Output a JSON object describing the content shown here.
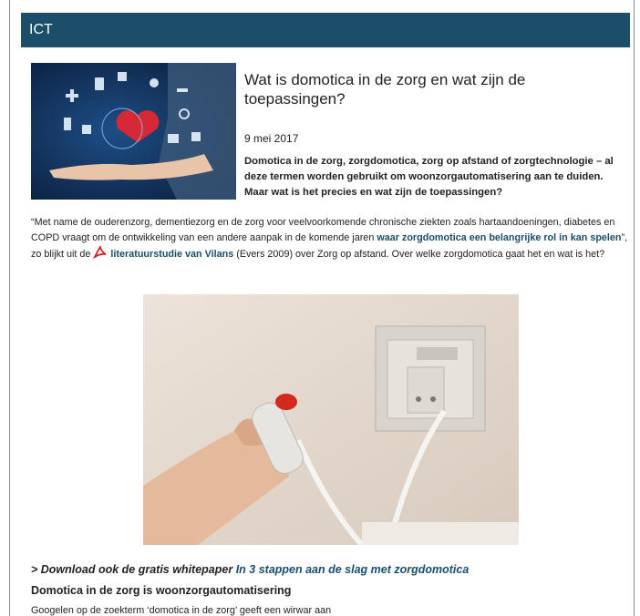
{
  "header": {
    "title": "ICT"
  },
  "article": {
    "thumbnail_icon": "medical-hand-icons-image",
    "title": "Wat is domotica in de zorg en wat zijn de toepassingen?",
    "date": "9 mei 2017",
    "lead": "Domotica in de zorg, zorgdomotica, zorg op afstand of zorgtechnologie – al deze termen worden gebruikt om woonzorgautomatisering aan te duiden. Maar wat is het precies en wat zijn de toepassingen?",
    "para": {
      "part1": "“Met name de ouderenzorg, dementiezorg en de zorg voor veelvoorkomende chronische ziekten zoals hartaandoeningen, diabetes en COPD vraagt om de ontwikkeling van een andere aanpak in de komende jaren ",
      "link1": "waar zorgdomotica een belangrijke rol in kan spelen",
      "part2": "”, zo blijkt uit de ",
      "link2": "literatuurstudie van Vilans",
      "part3": " (Evers 2009) over Zorg op afstand. Over welke zorgdomotica gaat het en wat is het?"
    },
    "photo_icon": "alarm-button-image",
    "download": {
      "prefix": "> Download ook de gratis whitepaper ",
      "link": "In 3 stappen aan de slag met zorgdomotica"
    },
    "subheading": "Domotica in de zorg is woonzorgautomatisering",
    "next_line": "Googelen op de zoekterm ‘domotica in de zorg’ geeft een wirwar aan"
  },
  "colors": {
    "header_bg": "#1a4e69",
    "link": "#1a4e69"
  }
}
